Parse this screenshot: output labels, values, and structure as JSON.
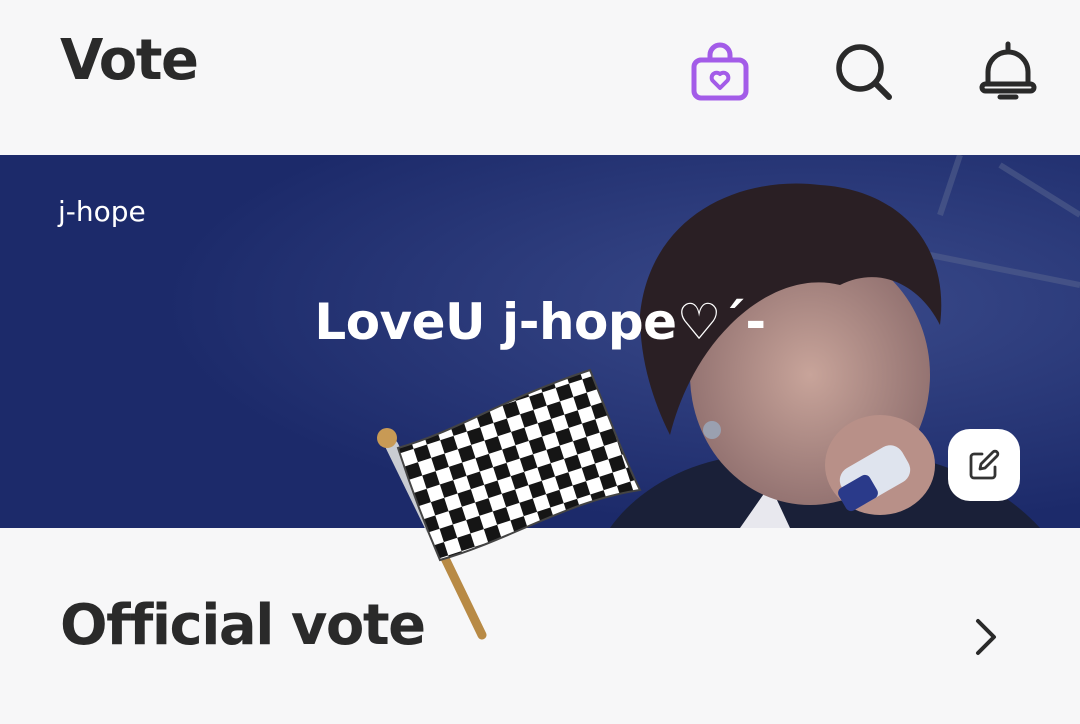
{
  "header": {
    "title": "Vote",
    "icons": [
      "shopping-bag-heart-icon",
      "search-icon",
      "bell-icon"
    ],
    "accent_color": "#a35ce8"
  },
  "banner": {
    "artist": "j-hope",
    "message": "LoveU j-hope♡ˊ-",
    "background_color": "#1c2a6a",
    "edit_icon": "edit-icon"
  },
  "decoration": {
    "emoji": "checkered-flag"
  },
  "section": {
    "title": "Official vote",
    "icon": "chevron-right-icon"
  }
}
